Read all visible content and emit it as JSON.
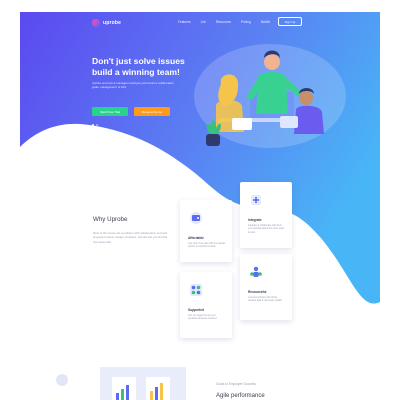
{
  "nav": {
    "brand": "uprobe",
    "menu": [
      "Features",
      "Job",
      "Resources",
      "Pricing",
      "Mobile"
    ],
    "signup_label": "Sign Up"
  },
  "hero": {
    "title_line1": "Don't just solve issues",
    "title_line2": "build a winning team!",
    "description": "Uprobe procures & manages employee performance collaboration goals, management, & OKs",
    "primary_button": "Start Free Trial",
    "secondary_button": "Request Demo"
  },
  "why": {
    "title": "Why Uprobe",
    "description": "Most of the issues are a problem with collaboration and well proposed means, design, timelines. Uprobe lets you find the true issue with."
  },
  "cards": [
    {
      "title": "Affordable",
      "description": "Low cost of our plan with our various options & combine benefits"
    },
    {
      "title": "Integrate",
      "description": "Integrate & collaborate with all of your existing data & the entire team & tools"
    },
    {
      "title": "Supported",
      "description": "Use our support to get your questions & issues resolved"
    },
    {
      "title": "Resourceful",
      "description": "A resource library with all the relevant data & necessary details"
    }
  ],
  "bottom": {
    "eyebrow": "Goals to Employee Success",
    "heading": "Agile performance"
  },
  "colors": {
    "hero_gradient_start": "#5b49f0",
    "hero_gradient_end": "#49b4f5",
    "primary_button": "#2ad38b",
    "secondary_button": "#ff9b1a"
  }
}
